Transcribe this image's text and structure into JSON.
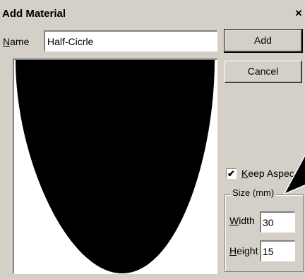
{
  "window": {
    "title": "Add Material",
    "close_glyph": "×"
  },
  "name": {
    "label_first": "N",
    "label_rest": "ame",
    "value": "Half-Cicrle"
  },
  "buttons": {
    "add_label": "Add",
    "cancel_label": "Cancel"
  },
  "keep_aspect": {
    "checked": true,
    "check_glyph": "✔",
    "label_first": "K",
    "label_rest": "eep Aspec"
  },
  "size_group": {
    "label": "Size (mm)",
    "width_label_first": "W",
    "width_label_rest": "idth",
    "width_value": "30",
    "height_label_first": "H",
    "height_label_rest": "eight",
    "height_value": "15"
  },
  "preview": {
    "shape": "half-circle",
    "fill_color": "#000000",
    "background_color": "#ffffff"
  }
}
